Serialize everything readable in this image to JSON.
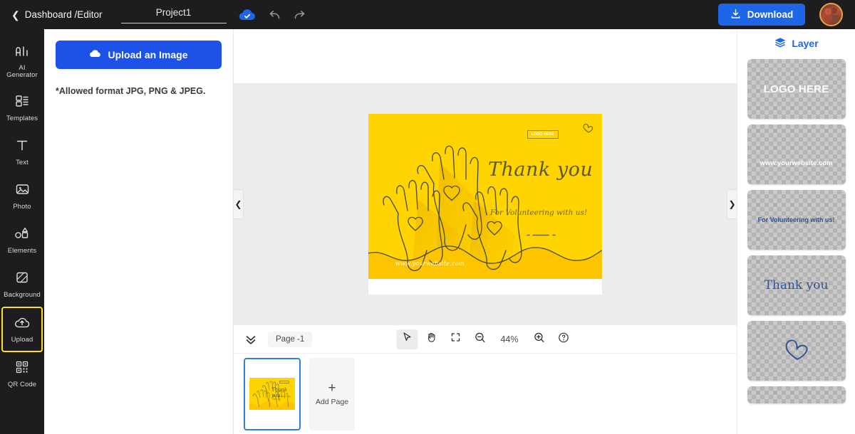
{
  "topbar": {
    "back_icon": "chevron-left-icon",
    "breadcrumb": "Dashboard /Editor",
    "project_name": "Project1",
    "project_placeholder": "Project name",
    "save_icon": "cloud-check-icon",
    "undo_icon": "undo-icon",
    "redo_icon": "redo-icon",
    "download_label": "Download",
    "download_icon": "download-icon",
    "avatar_name": "user-avatar",
    "accent_blue": "#1e66e8",
    "bar_bg": "#1d1d1f"
  },
  "rail": {
    "items": [
      {
        "label": "AI\nGenerator",
        "label_line1": "AI",
        "label_line2": "Generator",
        "icon": "ai-icon",
        "active": false
      },
      {
        "label": "Templates",
        "icon": "templates-icon",
        "active": false
      },
      {
        "label": "Text",
        "icon": "text-icon",
        "active": false
      },
      {
        "label": "Photo",
        "icon": "photo-icon",
        "active": false
      },
      {
        "label": "Elements",
        "icon": "elements-icon",
        "active": false
      },
      {
        "label": "Background",
        "icon": "background-icon",
        "active": false
      },
      {
        "label": "Upload",
        "icon": "upload-cloud-icon",
        "active": true
      },
      {
        "label": "QR Code",
        "icon": "qr-code-icon",
        "active": false
      }
    ],
    "active_outline_color": "#ffe01b"
  },
  "panel": {
    "upload_button_label": "Upload an Image",
    "upload_button_icon": "cloud-upload-icon",
    "allowed_note": "*Allowed format JPG, PNG & JPEG.",
    "button_color": "#1e51e8"
  },
  "canvas": {
    "nav_left_icon": "chevron-left-icon",
    "nav_right_icon": "chevron-right-icon",
    "background": "#ececec",
    "card": {
      "bg_color": "#ffd400",
      "logo_box_text": "LOGO HERE",
      "heart_icon": "heart-outline-icon",
      "heading": "Thank you",
      "subheading": "For Volunteering with us!",
      "website": "www.yourwebsite.com",
      "artwork": "raised-hands-line-art"
    }
  },
  "bottombar": {
    "collapse_icon": "double-chevron-down-icon",
    "page_chip": "Page -1",
    "tools": [
      {
        "name": "select-tool",
        "icon": "cursor-arrow-icon",
        "selected": true
      },
      {
        "name": "pan-tool",
        "icon": "hand-icon",
        "selected": false
      },
      {
        "name": "fit-screen-tool",
        "icon": "fit-screen-icon",
        "selected": false
      },
      {
        "name": "zoom-out",
        "icon": "zoom-out-icon",
        "selected": false
      }
    ],
    "zoom_value": "44%",
    "zoom_in_icon": "zoom-in-icon",
    "help_icon": "help-circle-icon"
  },
  "pages": {
    "add_page_label": "Add Page",
    "add_page_icon": "plus-icon",
    "thumb_heading": "Thank you",
    "thumb_sub": "For Volunteering with us!",
    "selected_border": "#2f7fe3"
  },
  "layers": {
    "title": "Layer",
    "title_icon": "layers-stack-icon",
    "items": [
      {
        "name": "layer-logo-here",
        "text": "LOGO HERE",
        "kind": "text-white"
      },
      {
        "name": "layer-website",
        "text": "www.yourwebsite.com",
        "kind": "text-white-small"
      },
      {
        "name": "layer-volunteering",
        "text": "For Volunteering with us!",
        "kind": "text-blue-small"
      },
      {
        "name": "layer-thank-you",
        "text": "Thank you",
        "kind": "text-blue-serif"
      },
      {
        "name": "layer-heart",
        "text": "",
        "kind": "heart-icon"
      },
      {
        "name": "layer-partial",
        "text": "",
        "kind": "empty"
      }
    ]
  }
}
